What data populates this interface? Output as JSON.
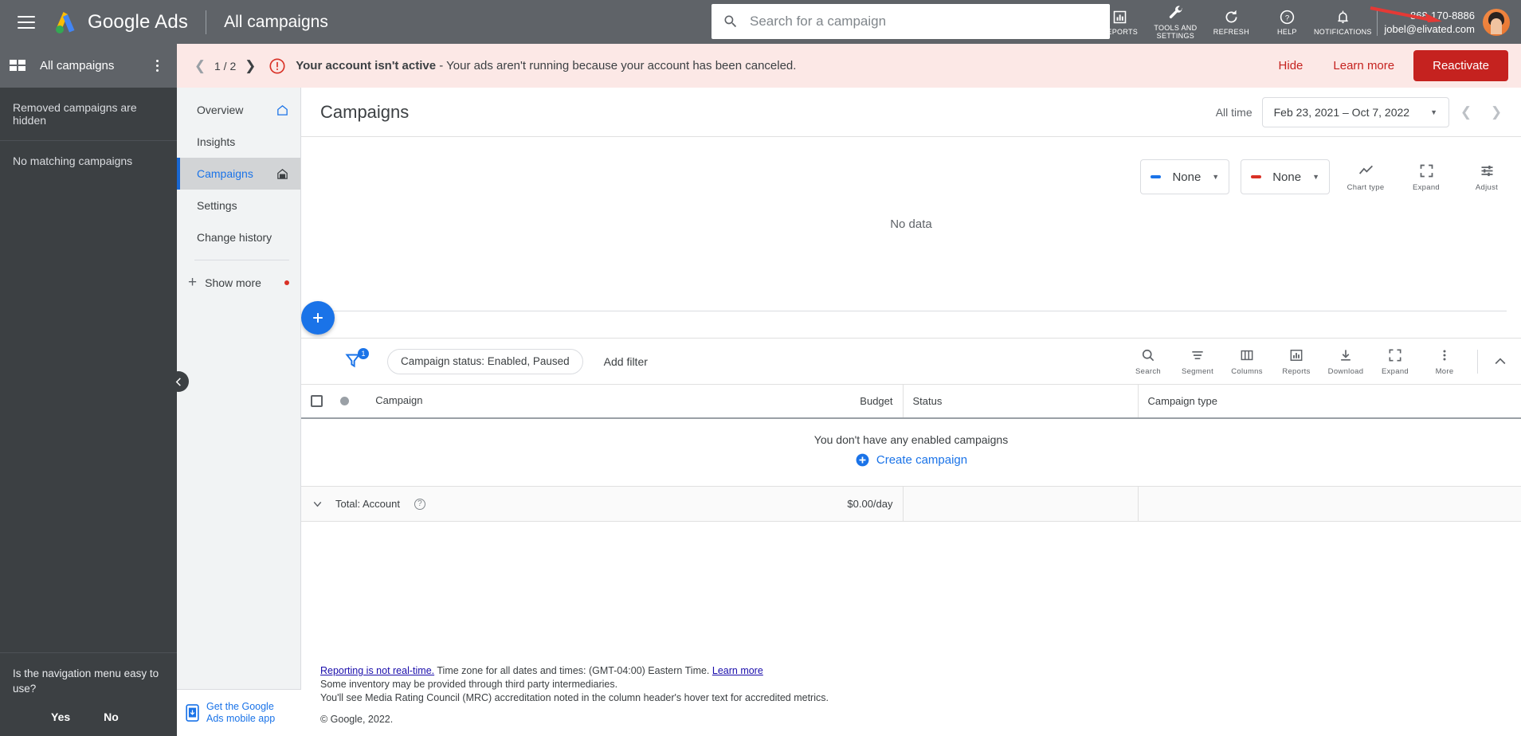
{
  "topbar": {
    "brand": "Google Ads",
    "page_context": "All campaigns",
    "menu_icon": "hamburger-menu-icon",
    "search": {
      "placeholder": "Search for a campaign",
      "value": "",
      "icon": "search-icon"
    },
    "actions": [
      {
        "label": "Reports",
        "icon": "reports-bar-chart-icon"
      },
      {
        "label": "Tools and settings",
        "icon": "wrench-tools-icon"
      },
      {
        "label": "Refresh",
        "icon": "refresh-icon"
      },
      {
        "label": "Help",
        "icon": "help-question-icon"
      },
      {
        "label": "Notifications",
        "icon": "bell-icon"
      }
    ],
    "account": {
      "id": "868-170-8886",
      "email": "jobel@elivated.com",
      "avatar": "user-avatar"
    }
  },
  "banner": {
    "index": "1 / 2",
    "prev_icon": "chevron-left-icon",
    "next_icon": "chevron-right-icon",
    "alert_icon": "error-exclamation-icon",
    "headline": "Your account isn't active",
    "separator": " - ",
    "message": "Your ads aren't running because your account has been canceled.",
    "hide_label": "Hide",
    "learn_more_label": "Learn more",
    "reactivate_label": "Reactivate",
    "bg_color": "#fce8e6",
    "accent_color": "#c5221f"
  },
  "left_panel": {
    "title": "All campaigns",
    "grid_icon": "grid-apps-icon",
    "kebab_icon": "more-vertical-icon",
    "rows": [
      {
        "label": "Removed campaigns are hidden"
      },
      {
        "label": "No matching campaigns"
      }
    ],
    "collapse_icon": "chevron-left-collapse-icon",
    "survey": {
      "question": "Is the navigation menu easy to use?",
      "yes_label": "Yes",
      "no_label": "No"
    }
  },
  "nav": {
    "items": [
      {
        "label": "Overview",
        "active": false,
        "pin_icon": "home-outline-icon"
      },
      {
        "label": "Insights",
        "active": false,
        "pin_icon": null
      },
      {
        "label": "Campaigns",
        "active": true,
        "pin_icon": "home-filled-icon"
      },
      {
        "label": "Settings",
        "active": false,
        "pin_icon": null
      },
      {
        "label": "Change history",
        "active": false,
        "pin_icon": null
      }
    ],
    "show_more_label": "Show more",
    "show_more_icon": "plus-icon",
    "mobile_app": {
      "line1": "Get the Google",
      "line2": "Ads mobile app",
      "icon": "mobile-phone-icon"
    }
  },
  "page": {
    "title": "Campaigns",
    "date": {
      "preset_label": "All time",
      "range": "Feb 23, 2021 – Oct 7, 2022",
      "dropdown_icon": "chevron-down-icon",
      "prev_icon": "chevron-left-icon",
      "next_icon": "chevron-right-icon"
    }
  },
  "chart": {
    "no_data_text": "No data",
    "metric_primary": {
      "label": "None",
      "color": "#1a73e8",
      "dropdown_icon": "chevron-down-icon"
    },
    "metric_secondary": {
      "label": "None",
      "color": "#d93025",
      "dropdown_icon": "chevron-down-icon"
    },
    "buttons": [
      {
        "label": "Chart type",
        "icon": "line-chart-icon"
      },
      {
        "label": "Expand",
        "icon": "expand-icon"
      },
      {
        "label": "Adjust",
        "icon": "adjust-sliders-icon"
      }
    ]
  },
  "toolbar": {
    "fab_icon": "plus-add-icon",
    "filter_icon": "filter-funnel-icon",
    "filter_badge": "1",
    "filter_chip": "Campaign status: Enabled, Paused",
    "add_filter_label": "Add filter",
    "buttons": [
      {
        "label": "Search",
        "icon": "search-icon"
      },
      {
        "label": "Segment",
        "icon": "segment-lines-icon"
      },
      {
        "label": "Columns",
        "icon": "columns-icon"
      },
      {
        "label": "Reports",
        "icon": "reports-bar-chart-icon"
      },
      {
        "label": "Download",
        "icon": "download-icon"
      },
      {
        "label": "Expand",
        "icon": "expand-icon"
      },
      {
        "label": "More",
        "icon": "more-vertical-icon"
      }
    ],
    "collapse_icon": "chevron-up-icon"
  },
  "table": {
    "select_all_icon": "checkbox-unchecked-icon",
    "status_dot_icon": "status-circle-icon",
    "columns": [
      {
        "label": "Campaign",
        "align": "left"
      },
      {
        "label": "Budget",
        "align": "right"
      },
      {
        "label": "Status",
        "align": "left"
      },
      {
        "label": "Campaign type",
        "align": "left"
      }
    ],
    "empty_state": {
      "message": "You don't have any enabled campaigns",
      "cta_label": "Create campaign",
      "cta_icon": "plus-circle-icon"
    },
    "total_row": {
      "expand_icon": "chevron-down-icon",
      "label": "Total: Account",
      "help_icon": "help-question-icon",
      "budget": "$0.00/day",
      "status": "",
      "campaign_type": ""
    }
  },
  "footer": {
    "link1": "Reporting is not real-time.",
    "text1": " Time zone for all dates and times: (GMT-04:00) Eastern Time. ",
    "link2": "Learn more",
    "line2": "Some inventory may be provided through third party intermediaries.",
    "line3": "You'll see Media Rating Council (MRC) accreditation noted in the column header's hover text for accredited metrics.",
    "copyright": "© Google, 2022."
  }
}
